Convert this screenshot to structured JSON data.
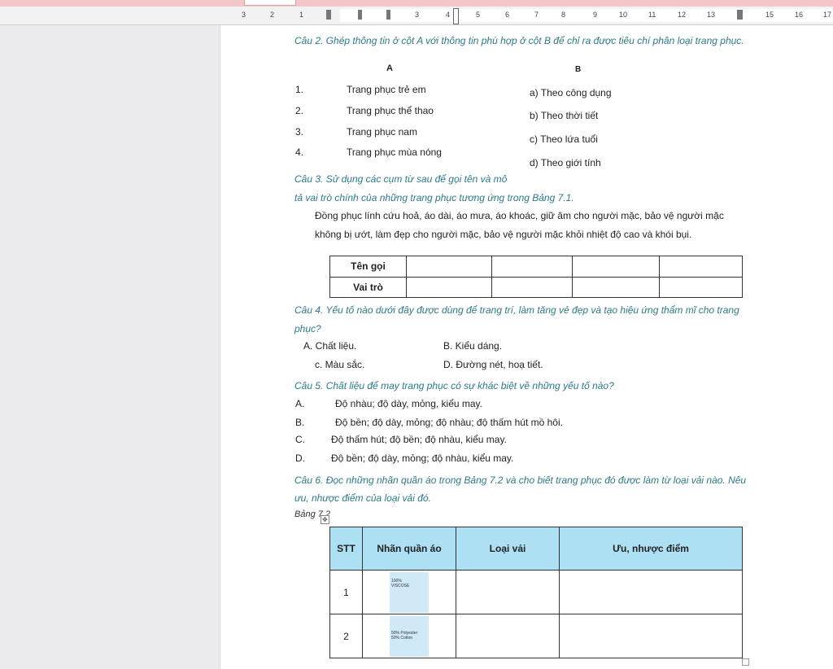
{
  "ruler": {
    "numbers": [
      "3",
      "2",
      "1",
      "",
      "",
      "1",
      "2",
      "3",
      "4",
      "5",
      "6",
      "7",
      "8",
      "9",
      "10",
      "11",
      "12",
      "13",
      "14",
      "15",
      "16",
      "17"
    ]
  },
  "q2": {
    "title": "Câu 2. Ghép thông tin ở cột A với thông tin phù hợp ở cột B để chỉ ra được tiêu chí phân loại trang phục.",
    "head_a": "A",
    "head_b": "B",
    "col_a": [
      {
        "num": "1.",
        "text": "Trang phục trẻ em"
      },
      {
        "num": "2.",
        "text": "Trang phục thể thao"
      },
      {
        "num": "3.",
        "text": "Trang phục nam"
      },
      {
        "num": "4.",
        "text": "Trang phục mùa nóng"
      }
    ],
    "col_b": [
      "a) Theo công dụng",
      "b) Theo thời tiết",
      "c) Theo lứa tuổi",
      "d) Theo giới tính"
    ]
  },
  "q3": {
    "title1": "Câu 3. Sử dụng các cụm từ sau để gọi tên và mô",
    "title2": "tả vai trò chính của những trang phục tương ứng trong Bảng 7.1.",
    "body1": "Đồng phục lính cứu hoả, áo dài, áo mưa, áo khoác, giữ âm cho người mặc, bảo vệ người mặc",
    "body2": "không bị ướt, làm đẹp cho người mặc, bảo vệ người mặc khỏi nhiệt độ cao và khói bụi.",
    "row1": "Tên gọi",
    "row2": "Vai trò"
  },
  "q4": {
    "title1": "Câu 4. Yếu tố nào dưới đây được dùng để trang trí, làm tăng vẻ đẹp và tạo hiệu ứng thẩm mĩ cho trang",
    "title2": "phục?",
    "a": "A. Chất liệu.",
    "b": "B. Kiểu dáng.",
    "c": "c. Màu sắc.",
    "d": "D. Đường nét, hoạ tiết."
  },
  "q5": {
    "title": "Câu 5. Chất liệu để may trang phục có sự khác biệt về những yếu tố nào?",
    "options": [
      {
        "letter": "A.",
        "text": "Độ nhàu; độ dày, mỏng, kiểu may."
      },
      {
        "letter": "B.",
        "text": "Độ bền; độ dày, mỏng; độ nhàu; độ thấm hút mồ hôi."
      },
      {
        "letter": "C.",
        "text": "Độ thấm hút; độ bền; độ nhàu, kiểu may."
      },
      {
        "letter": "D.",
        "text": "Độ bền; độ dày, mỏng; độ nhàu, kiểu may."
      }
    ]
  },
  "q6": {
    "title1": "Câu 6. Đọc những nhãn quần áo trong Bảng 7.2 và cho biết trang phục đó được làm từ loại vải nào. Nêu",
    "title2": "ưu, nhược điểm của loại vải đó.",
    "caption": "Bảng 7.2",
    "headers": [
      "STT",
      "Nhãn quần áo",
      "Loại vải",
      "Ưu, nhược điểm"
    ],
    "rows": [
      {
        "stt": "1",
        "label_line1": "100%",
        "label_line2": "VISCOSE"
      },
      {
        "stt": "2",
        "label_line1": "50% Polyester",
        "label_line2": "50% Cotton"
      }
    ]
  }
}
